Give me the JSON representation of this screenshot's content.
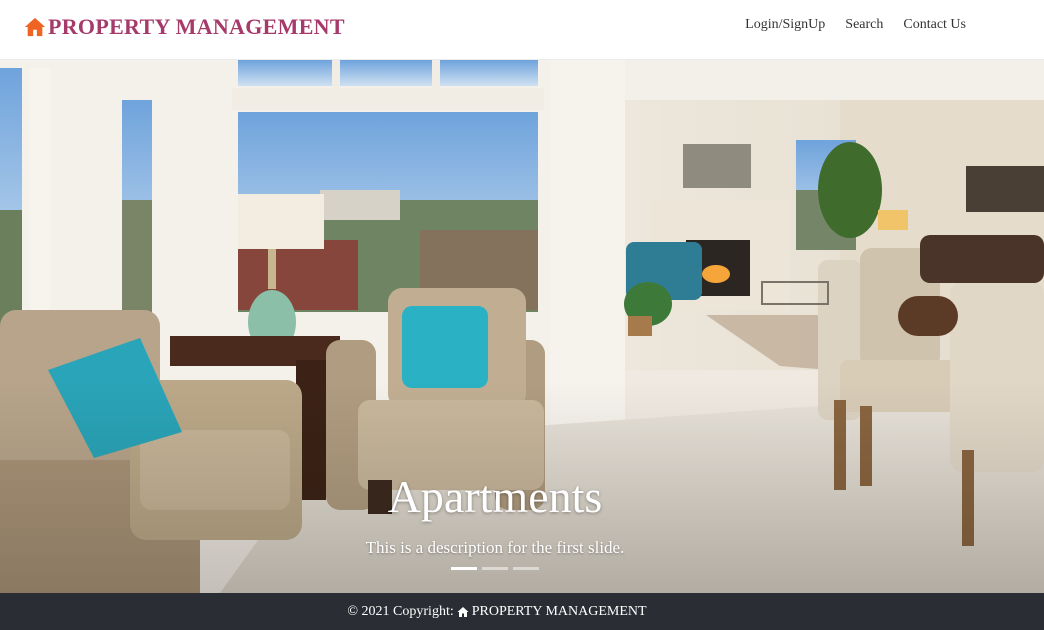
{
  "navbar": {
    "brand_text": "PROPERTY MANAGEMENT",
    "brand_icon": "home-icon",
    "brand_color": "#a63a6a",
    "icon_color": "#f06423",
    "links": [
      "Login/SignUp",
      "Search",
      "Contact Us"
    ]
  },
  "carousel": {
    "slide_title": "Apartments",
    "slide_description": "This is a description for the first slide.",
    "slide_count": 3,
    "active_slide": 1
  },
  "footer": {
    "copyright_prefix": "© 2021 Copyright:",
    "brand_text": "PROPERTY MANAGEMENT",
    "brand_icon": "home-icon",
    "background": "#2a2e34"
  }
}
